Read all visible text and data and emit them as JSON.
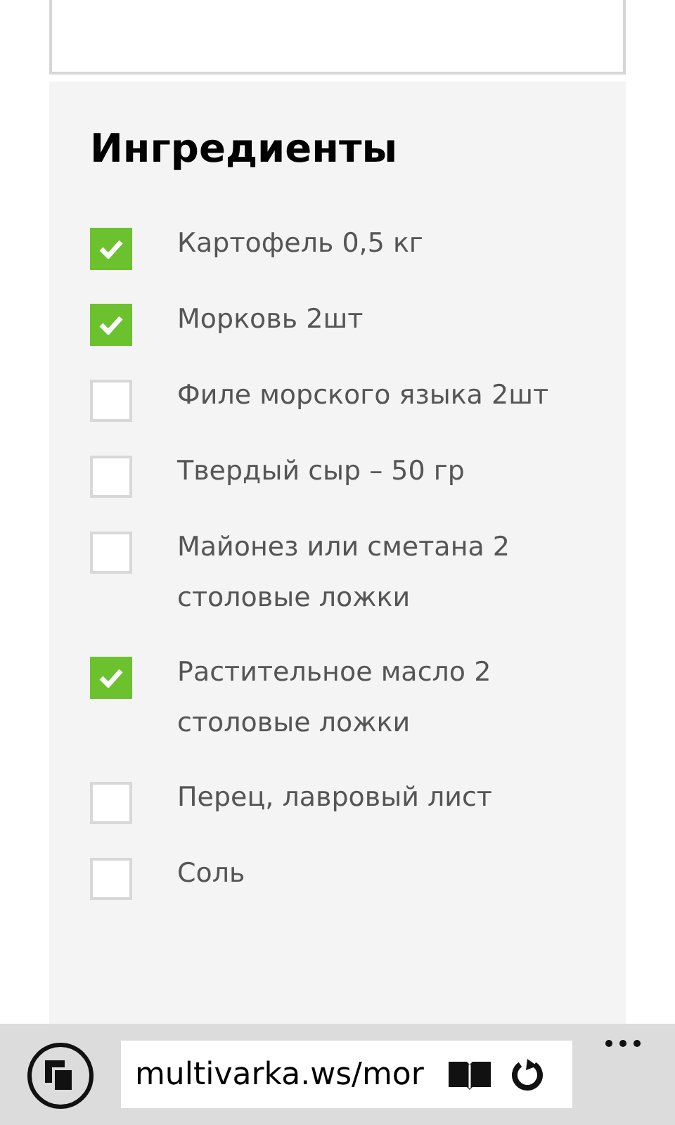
{
  "ingredients": {
    "title": "Ингредиенты",
    "items": [
      {
        "label": "Картофель 0,5 кг",
        "checked": true
      },
      {
        "label": "Морковь 2шт",
        "checked": true
      },
      {
        "label": "Филе морского языка 2шт",
        "checked": false
      },
      {
        "label": "Твердый сыр – 50 гр",
        "checked": false
      },
      {
        "label": "Майонез или сметана 2 столовые ложки",
        "checked": false
      },
      {
        "label": "Растительное масло 2 столовые ложки",
        "checked": true
      },
      {
        "label": "Перец, лавровый лист",
        "checked": false
      },
      {
        "label": "Соль",
        "checked": false
      }
    ]
  },
  "address_bar": {
    "url": "multivarka.ws/mor"
  }
}
